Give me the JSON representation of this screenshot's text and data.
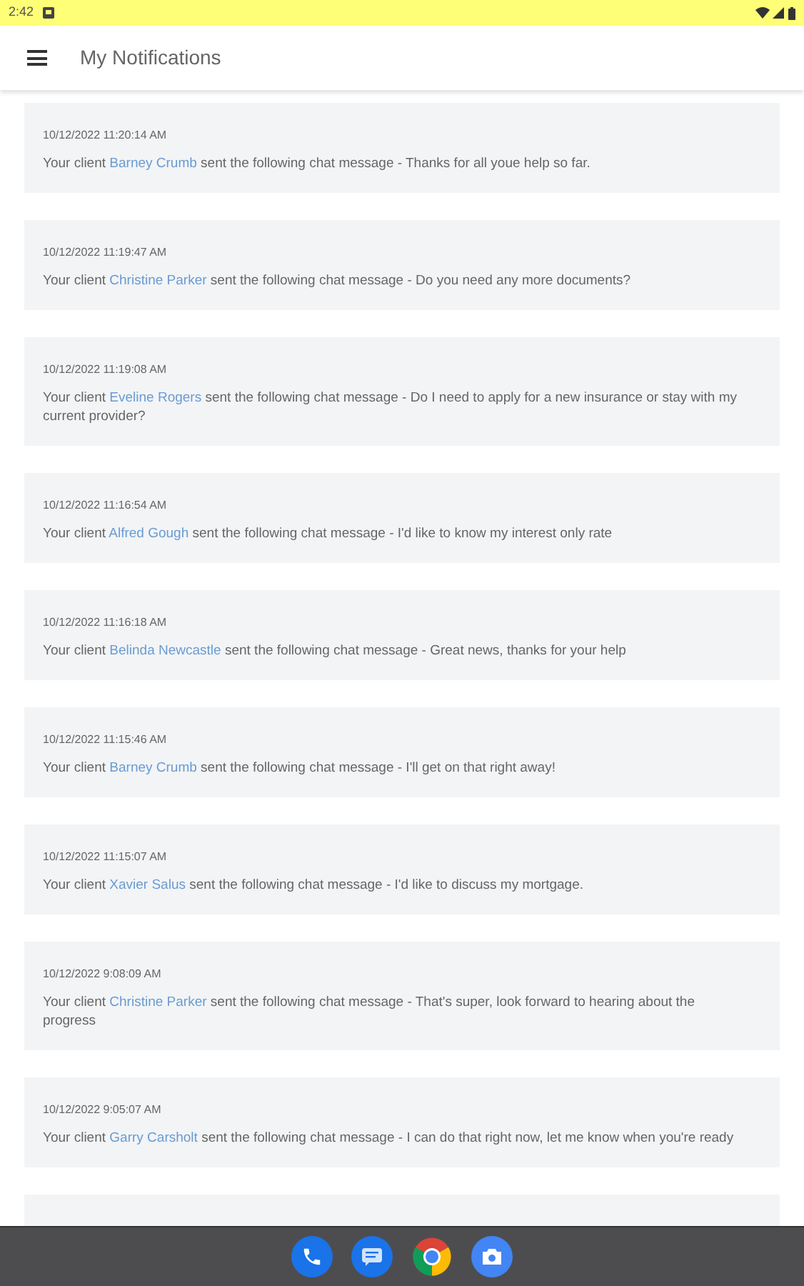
{
  "status_bar": {
    "time": "2:42"
  },
  "app_bar": {
    "title": "My Notifications"
  },
  "notifications": [
    {
      "timestamp": "10/12/2022 11:20:14 AM",
      "prefix": "Your client",
      "client": "Barney Crumb",
      "text": "sent the following chat message - Thanks for all youe help so far."
    },
    {
      "timestamp": "10/12/2022 11:19:47 AM",
      "prefix": "Your client",
      "client": "Christine Parker",
      "text": "sent the following chat message - Do you need any more documents?"
    },
    {
      "timestamp": "10/12/2022 11:19:08 AM",
      "prefix": "Your client",
      "client": "Eveline Rogers",
      "text": "sent the following chat message - Do I need to apply for a new insurance or stay with my current provider?"
    },
    {
      "timestamp": "10/12/2022 11:16:54 AM",
      "prefix": "Your client",
      "client": "Alfred Gough",
      "text": "sent the following chat message - I'd like to know my interest only rate"
    },
    {
      "timestamp": "10/12/2022 11:16:18 AM",
      "prefix": "Your client",
      "client": "Belinda Newcastle",
      "text": "sent the following chat message - Great news, thanks for your help"
    },
    {
      "timestamp": "10/12/2022 11:15:46 AM",
      "prefix": "Your client",
      "client": "Barney Crumb",
      "text": "sent the following chat message - I'll get on that right away!"
    },
    {
      "timestamp": "10/12/2022 11:15:07 AM",
      "prefix": "Your client",
      "client": "Xavier Salus",
      "text": "sent the following chat message - I'd like to discuss my mortgage."
    },
    {
      "timestamp": "10/12/2022 9:08:09 AM",
      "prefix": "Your client",
      "client": "Christine Parker",
      "text": "sent the following chat message - That's super, look forward to hearing about the progress"
    },
    {
      "timestamp": "10/12/2022 9:05:07 AM",
      "prefix": "Your client",
      "client": "Garry Carsholt",
      "text": "sent the following chat message - I can do that right now, let me know when you're ready"
    }
  ]
}
